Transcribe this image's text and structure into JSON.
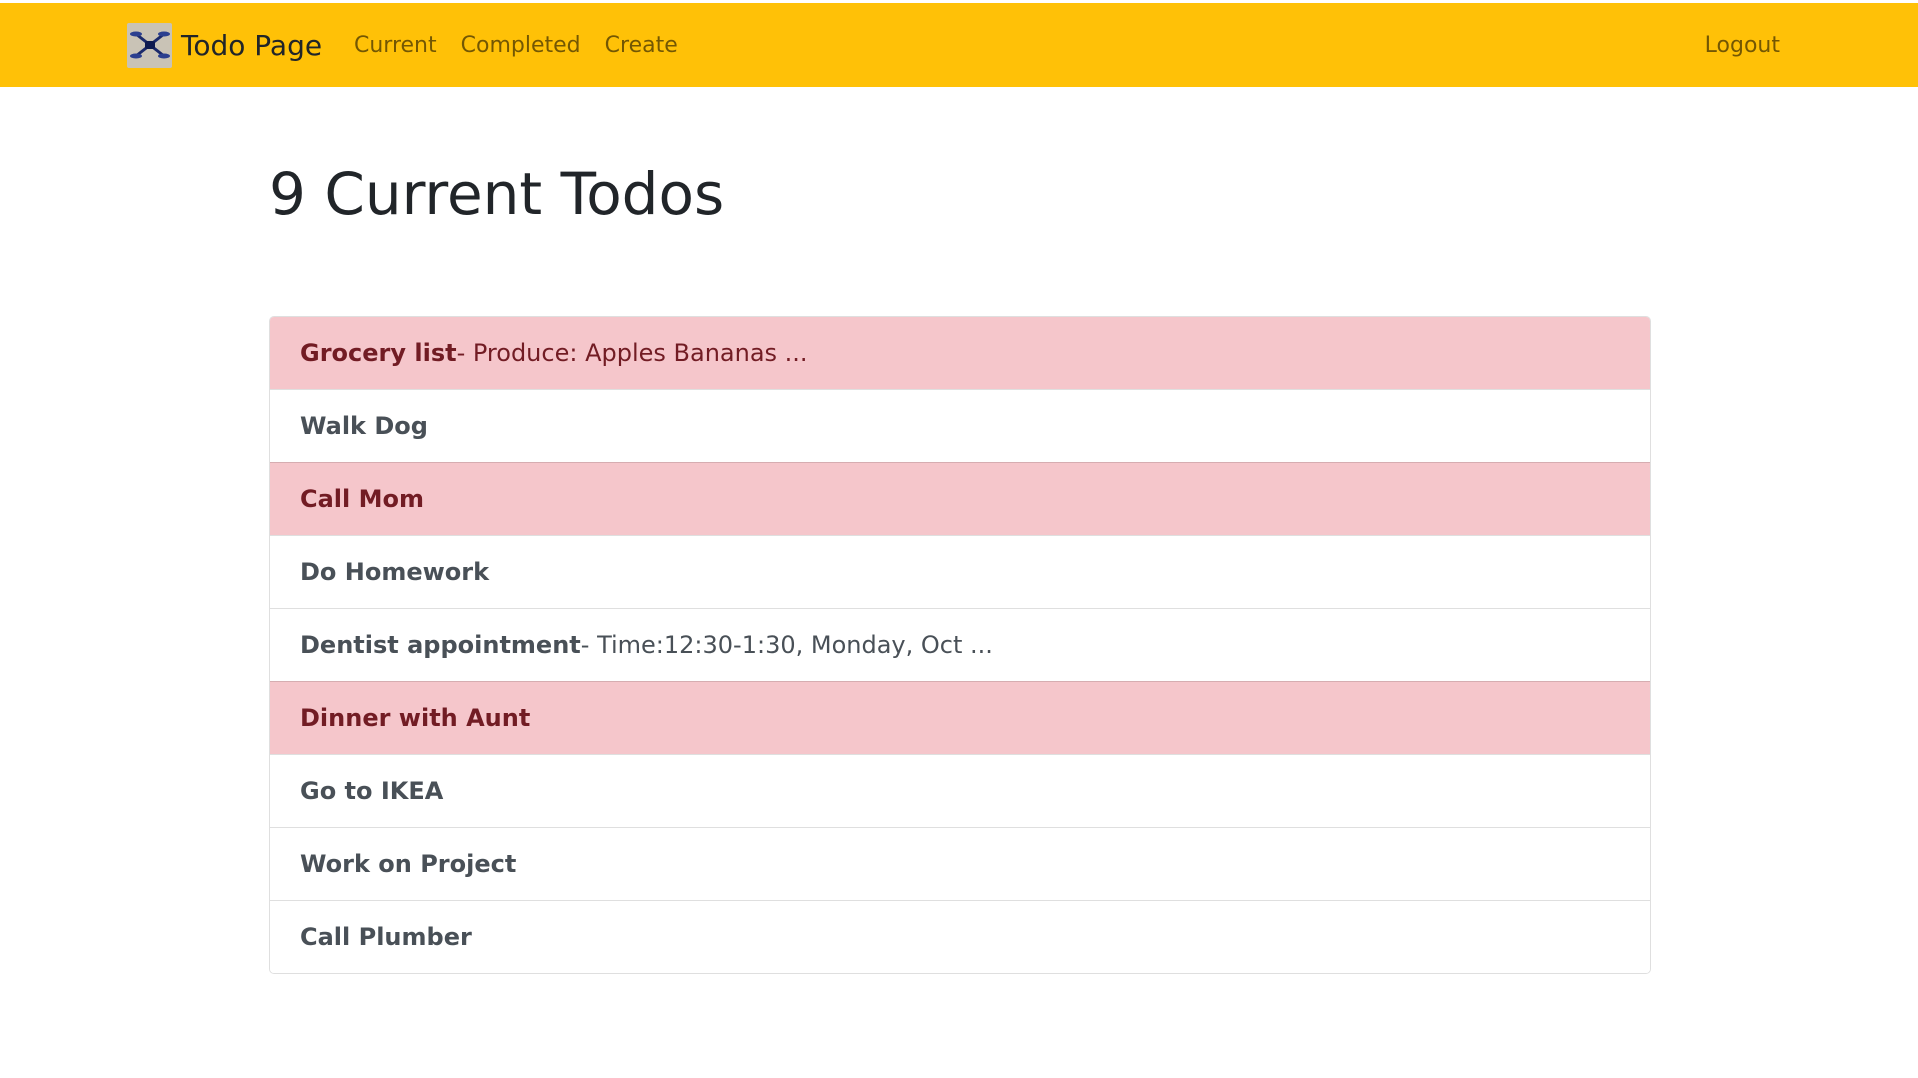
{
  "navbar": {
    "brand_text": "Todo Page",
    "brand_icon": "drone-logo-icon",
    "links": [
      {
        "label": "Current"
      },
      {
        "label": "Completed"
      },
      {
        "label": "Create"
      }
    ],
    "logout_label": "Logout",
    "background_color": "#ffc107"
  },
  "main": {
    "title": "9 Current Todos"
  },
  "todos": [
    {
      "title": "Grocery list",
      "description": " - Produce: Apples Bananas ...",
      "highlighted": true
    },
    {
      "title": "Walk Dog",
      "description": "",
      "highlighted": false
    },
    {
      "title": "Call Mom",
      "description": "",
      "highlighted": true
    },
    {
      "title": "Do Homework",
      "description": "",
      "highlighted": false
    },
    {
      "title": "Dentist appointment",
      "description": " - Time:12:30-1:30, Monday, Oct ...",
      "highlighted": false
    },
    {
      "title": "Dinner with Aunt",
      "description": "",
      "highlighted": true
    },
    {
      "title": "Go to IKEA",
      "description": "",
      "highlighted": false
    },
    {
      "title": "Work on Project",
      "description": "",
      "highlighted": false
    },
    {
      "title": "Call Plumber",
      "description": "",
      "highlighted": false
    }
  ],
  "colors": {
    "highlight_background": "#f5c6cb",
    "highlight_text": "#721c24",
    "default_text": "#495057"
  }
}
